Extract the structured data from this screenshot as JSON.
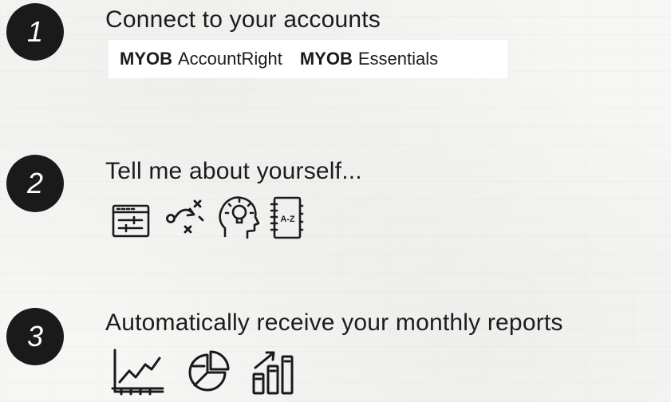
{
  "steps": [
    {
      "number": "1",
      "title": "Connect to your accounts",
      "products": [
        {
          "brand": "MYOB",
          "name": "AccountRight"
        },
        {
          "brand": "MYOB",
          "name": "Essentials"
        }
      ]
    },
    {
      "number": "2",
      "title": "Tell me about yourself...",
      "icons": [
        "settings-panel-icon",
        "strategy-play-icon",
        "lightbulb-head-icon",
        "address-book-icon"
      ],
      "a_to_z": "A-Z"
    },
    {
      "number": "3",
      "title": "Automatically receive your monthly reports",
      "icons": [
        "line-chart-icon",
        "pie-chart-icon",
        "bar-chart-icon"
      ]
    }
  ],
  "colors": {
    "ink": "#1a1a1a",
    "badge_text": "#ffffff",
    "product_bar": "#ffffff"
  }
}
